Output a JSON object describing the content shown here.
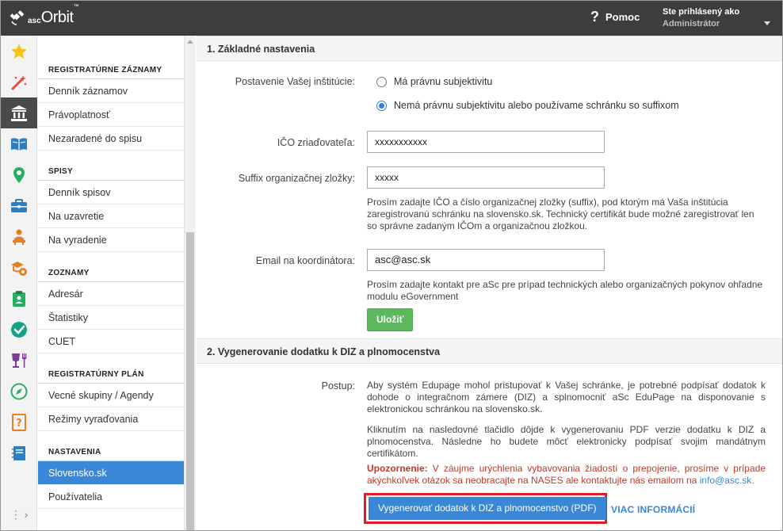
{
  "app": {
    "logo_prefix": "asc",
    "logo_name": "Orbit",
    "logo_tm": "™"
  },
  "header": {
    "help_icon": "?",
    "help_label": "Pomoc",
    "user_caption": "Ste prihlásený ako",
    "user_name": "Administrátor"
  },
  "rail": {
    "icons": [
      "star-icon",
      "magic-wand-icon",
      "institution-icon",
      "book-icon",
      "map-pin-icon",
      "briefcase-icon",
      "person-desk-icon",
      "school-gear-icon",
      "clipboard-person-icon",
      "check-circle-icon",
      "cup-fork-icon",
      "compass-icon",
      "question-book-icon",
      "notebook-icon"
    ],
    "active_index": 2,
    "more_label": "⋮ ›"
  },
  "menu": {
    "sections": [
      {
        "title": "REGISTRATÚRNE ZÁZNAMY",
        "items": [
          "Denník záznamov",
          "Právoplatnosť",
          "Nezaradené do spisu"
        ]
      },
      {
        "title": "SPISY",
        "items": [
          "Denník spisov",
          "Na uzavretie",
          "Na vyradenie"
        ]
      },
      {
        "title": "ZOZNAMY",
        "items": [
          "Adresár",
          "Štatistiky",
          "CUET"
        ]
      },
      {
        "title": "REGISTRATÚRNY PLÁN",
        "items": [
          "Vecné skupiny / Agendy",
          "Režimy vyraďovania"
        ]
      },
      {
        "title": "NASTAVENIA",
        "items": [
          "Slovensko.sk",
          "Používatelia"
        ]
      }
    ],
    "active_item": "Slovensko.sk"
  },
  "basic": {
    "title": "1. Základné nastavenia",
    "status_label": "Postavenie Vašej inštitúcie:",
    "option1": "Má právnu subjektivitu",
    "option2": "Nemá právnu subjektivitu alebo používame schránku so suffixom",
    "selected_option": 2,
    "ico_label": "IČO zriaďovateľa:",
    "ico_value": "xxxxxxxxxxx",
    "suffix_label": "Suffix organizačnej zložky:",
    "suffix_value": "xxxxx",
    "suffix_help": "Prosím zadajte IČO a číslo organizačnej zložky (suffix), pod ktorým má Vaša inštitúcia zaregistrovanú schránku na slovensko.sk. Technický certifikát bude možné zaregistrovať len so správne zadaným IČOm a organizačnou zložkou.",
    "email_label": "Email na koordinátora:",
    "email_value": "asc@asc.sk",
    "email_help": "Prosím zadajte kontakt pre aSc pre prípad technických alebo organizačných pokynov ohľadne modulu eGovernment",
    "save_label": "Uložiť"
  },
  "generate": {
    "title": "2. Vygenerovanie dodatku k DIZ a plnomocenstva",
    "procedure_label": "Postup:",
    "para1": "Aby systém Edupage mohol pristupovať k Vašej schránke, je potrebné podpísať dodatok k dohode o integračnom zámere (DIZ) a splnomocniť aSc EduPage na disponovanie s elektronickou schránkou na slovensko.sk.",
    "para2": "Kliknutím na nasledovné tlačidlo dôjde k vygenerovaniu PDF verzie dodatku k DIZ a plnomocenstva. Následne ho budete môcť elektronicky podpísať svojim mandátnym certifikátom.",
    "warning_label": "Upozornenie:",
    "warning_text": " V záujme urýchlenia vybavovania žiadostí o prepojenie, prosíme v prípade akýchkoľvek otázok sa neobracajte na NASES ale kontaktujte nás emailom na ",
    "warning_email": "info@asc.sk",
    "warning_end": ".",
    "generate_button": "Vygenerovať dodatok k DIZ a plnomocenstvo (PDF)",
    "more_link": "VIAC INFORMÁCIÍ"
  },
  "colors": {
    "topbar": "#3d3d3d",
    "accent": "#3a87d7",
    "save": "#5cb85c",
    "warning": "#c0392b",
    "highlight": "#e11d27"
  }
}
